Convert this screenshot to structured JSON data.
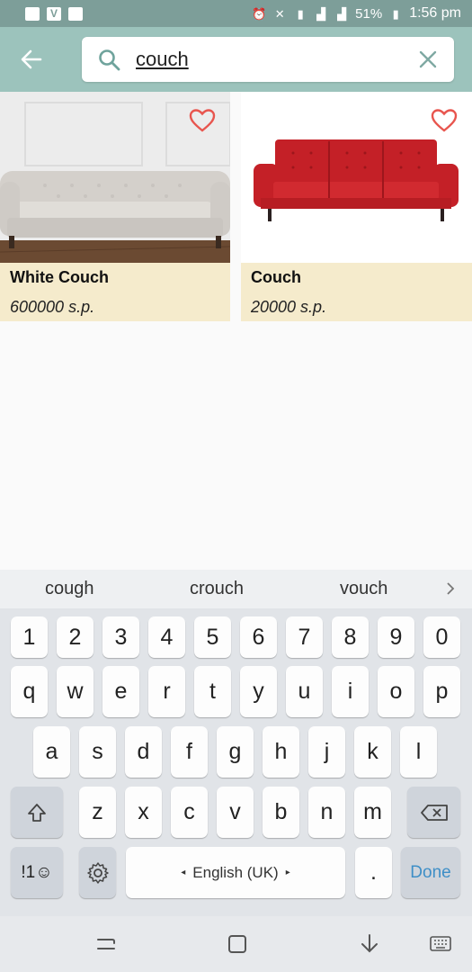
{
  "status_bar": {
    "battery": "51%",
    "time": "1:56 pm"
  },
  "search": {
    "value": "couch",
    "placeholder": "Search"
  },
  "products": [
    {
      "title": "White Couch",
      "price": "600000 s.p."
    },
    {
      "title": "Couch",
      "price": "20000 s.p."
    }
  ],
  "keyboard": {
    "suggestions": [
      "cough",
      "crouch",
      "vouch"
    ],
    "row_numbers": [
      "1",
      "2",
      "3",
      "4",
      "5",
      "6",
      "7",
      "8",
      "9",
      "0"
    ],
    "row1": [
      "q",
      "w",
      "e",
      "r",
      "t",
      "y",
      "u",
      "i",
      "o",
      "p"
    ],
    "row2": [
      "a",
      "s",
      "d",
      "f",
      "g",
      "h",
      "j",
      "k",
      "l"
    ],
    "row3": [
      "z",
      "x",
      "c",
      "v",
      "b",
      "n",
      "m"
    ],
    "symbols_label": "!1☺",
    "space_label": "English (UK)",
    "period_label": ".",
    "done_label": "Done"
  },
  "colors": {
    "app_bar": "#9cc3bc",
    "status_bar": "#7d9e99",
    "card_bg": "#f5ebcc",
    "heart": "#e8554e",
    "couch_red": "#c42027"
  }
}
